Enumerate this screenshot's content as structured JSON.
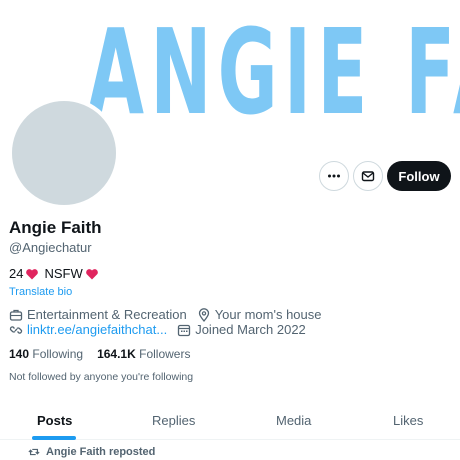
{
  "banner": {
    "text": "ANGIE FAITH"
  },
  "profile": {
    "name": "Angie Faith",
    "handle": "@Angiechatur",
    "bio_age": "24",
    "bio_tag": "NSFW",
    "translate_label": "Translate bio",
    "category": "Entertainment & Recreation",
    "location": "Your mom's house",
    "link": "linktr.ee/angiefaithchat...",
    "joined": "Joined March 2022",
    "following_count": "140",
    "following_label": "Following",
    "followers_count": "164.1K",
    "followers_label": "Followers",
    "not_followed": "Not followed by anyone you're following"
  },
  "actions": {
    "follow_label": "Follow"
  },
  "tabs": [
    {
      "label": "Posts",
      "active": true
    },
    {
      "label": "Replies",
      "active": false
    },
    {
      "label": "Media",
      "active": false
    },
    {
      "label": "Likes",
      "active": false
    }
  ],
  "feed": {
    "repost_text": "Angie Faith reposted"
  },
  "colors": {
    "accent": "#1d9bf0",
    "banner_text": "#7ec8f5",
    "heart": "#e0245e"
  }
}
